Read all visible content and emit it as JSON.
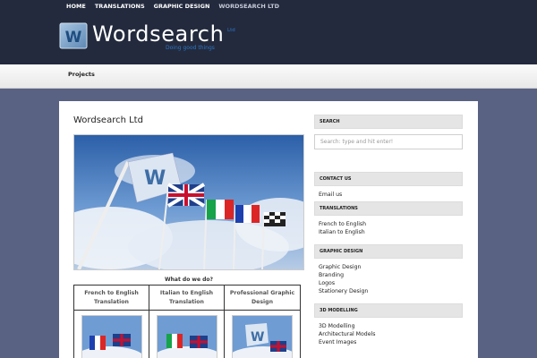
{
  "topnav": [
    "HOME",
    "TRANSLATIONS",
    "GRAPHIC DESIGN",
    "WORDSEARCH LTD"
  ],
  "logo": {
    "text": "Wordsearch",
    "ltd": "Ltd",
    "tagline": "Doing good things",
    "letter": "W"
  },
  "secondary_nav": {
    "projects": "Projects"
  },
  "main": {
    "title": "Wordsearch Ltd",
    "caption": "What do we do?",
    "services": [
      {
        "label": "French to English Translation"
      },
      {
        "label": "Italian to English Translation"
      },
      {
        "label": "Professional Graphic Design"
      }
    ]
  },
  "sidebar": {
    "search": {
      "heading": "SEARCH",
      "placeholder": "Search: type and hit enter!"
    },
    "contact": {
      "heading": "CONTACT US",
      "links": [
        "Email us"
      ]
    },
    "translations": {
      "heading": "TRANSLATIONS",
      "links": [
        "French to English",
        "Italian to English"
      ]
    },
    "graphic": {
      "heading": "GRAPHIC DESIGN",
      "links": [
        "Graphic Design",
        "Branding",
        "Logos",
        "Stationery Design"
      ]
    },
    "modelling": {
      "heading": "3D MODELLING",
      "links": [
        "3D Modelling",
        "Architectural Models",
        "Event Images"
      ]
    }
  },
  "colors": {
    "header_bg": "#232a3d",
    "page_bg": "#5a6283",
    "accent_blue": "#2d76c4"
  }
}
